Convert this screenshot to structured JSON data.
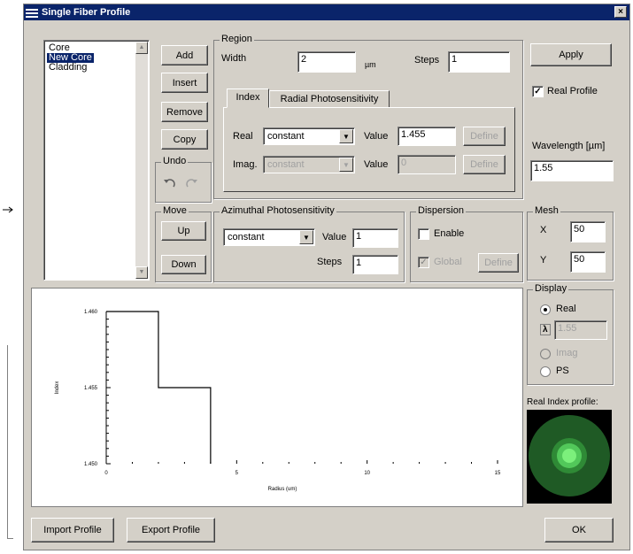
{
  "window": {
    "title": "Single Fiber Profile",
    "close_glyph": "×"
  },
  "layers": {
    "items": [
      "Core",
      "New Core",
      "Cladding"
    ],
    "selected_index": 1
  },
  "layer_buttons": {
    "add": "Add",
    "insert": "Insert",
    "remove": "Remove",
    "copy": "Copy"
  },
  "undo": {
    "label": "Undo"
  },
  "move": {
    "label": "Move",
    "up": "Up",
    "down": "Down"
  },
  "region": {
    "label": "Region",
    "width_label": "Width",
    "width_value": "2",
    "width_unit": "µm",
    "steps_label": "Steps",
    "steps_value": "1"
  },
  "index_tabs": {
    "tab1": "Index",
    "tab2": "Radial Photosensitivity"
  },
  "index": {
    "real_label": "Real",
    "real_type": "constant",
    "real_value_label": "Value",
    "real_value": "1.455",
    "real_define": "Define",
    "imag_label": "Imag.",
    "imag_type": "constant",
    "imag_value_label": "Value",
    "imag_value": "0",
    "imag_define": "Define"
  },
  "azimuthal": {
    "label": "Azimuthal Photosensitivity",
    "type": "constant",
    "value_label": "Value",
    "value": "1",
    "steps_label": "Steps",
    "steps_value": "1"
  },
  "dispersion": {
    "label": "Dispersion",
    "enable_label": "Enable",
    "enable_checked": false,
    "global_label": "Global",
    "global_checked": true,
    "define": "Define"
  },
  "apply_button": "Apply",
  "real_profile": {
    "label": "Real Profile",
    "checked": true
  },
  "wavelength": {
    "label": "Wavelength [µm]",
    "value": "1.55"
  },
  "mesh": {
    "label": "Mesh",
    "x_label": "X",
    "x_value": "50",
    "y_label": "Y",
    "y_value": "50"
  },
  "display": {
    "label": "Display",
    "real": "Real",
    "lambda_value": "1.55",
    "imag": "Imag",
    "ps": "PS",
    "selected": "Real"
  },
  "profile_preview": {
    "label": "Real Index profile:"
  },
  "bottom_buttons": {
    "import": "Import Profile",
    "export": "Export Profile",
    "ok": "OK"
  },
  "chart_data": {
    "type": "line",
    "xlabel": "Radius (um)",
    "ylabel": "Index",
    "x_ticks": [
      "0",
      "5",
      "10",
      "15"
    ],
    "y_ticks": [
      "1.460",
      "1.455",
      "1.450"
    ],
    "xlim": [
      0,
      15
    ],
    "ylim": [
      1.45,
      1.46
    ],
    "series": [
      {
        "x": [
          0,
          2,
          2,
          4,
          4
        ],
        "y": [
          1.46,
          1.46,
          1.455,
          1.455,
          1.45
        ]
      }
    ]
  },
  "colors": {
    "dialog_bg": "#d4d0c8",
    "titlebar": "#0a246a",
    "selection": "#0a246a",
    "profile_outer": "#1f5a25",
    "profile_core": "#7cf07c"
  }
}
